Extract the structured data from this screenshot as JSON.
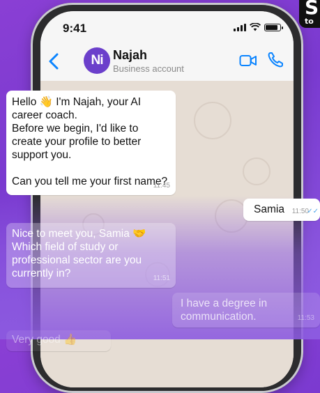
{
  "status_bar": {
    "time": "9:41"
  },
  "header": {
    "avatar_initials": "Ni",
    "contact_name": "Najah",
    "contact_subtitle": "Business account"
  },
  "icons": {
    "back": "chevron-left-icon",
    "video": "video-camera-icon",
    "call": "phone-icon"
  },
  "messages": [
    {
      "direction": "incoming",
      "text": "Hello 👋 I'm Najah, your AI career coach.\nBefore we begin, I'd like to create your profile to better support you.\n\nCan you tell me your first name?",
      "time": "11:45"
    },
    {
      "direction": "outgoing",
      "text": "Samia",
      "time": "11:50",
      "status": "read"
    },
    {
      "direction": "incoming",
      "text": "Nice to meet you, Samia 🤝\nWhich field of study or professional sector are you currently in?",
      "time": "11:51"
    },
    {
      "direction": "outgoing",
      "text": "I have a degree in communication.",
      "time": "11:53"
    },
    {
      "direction": "incoming",
      "text": "Very good 👍"
    }
  ],
  "corner_badge": {
    "glyph": "S",
    "text": "to"
  },
  "colors": {
    "background_purple": "#8a3fd4",
    "avatar": "#6b3fcb",
    "accent_blue": "#0a84ff",
    "read_ticks": "#4fa6e8"
  }
}
